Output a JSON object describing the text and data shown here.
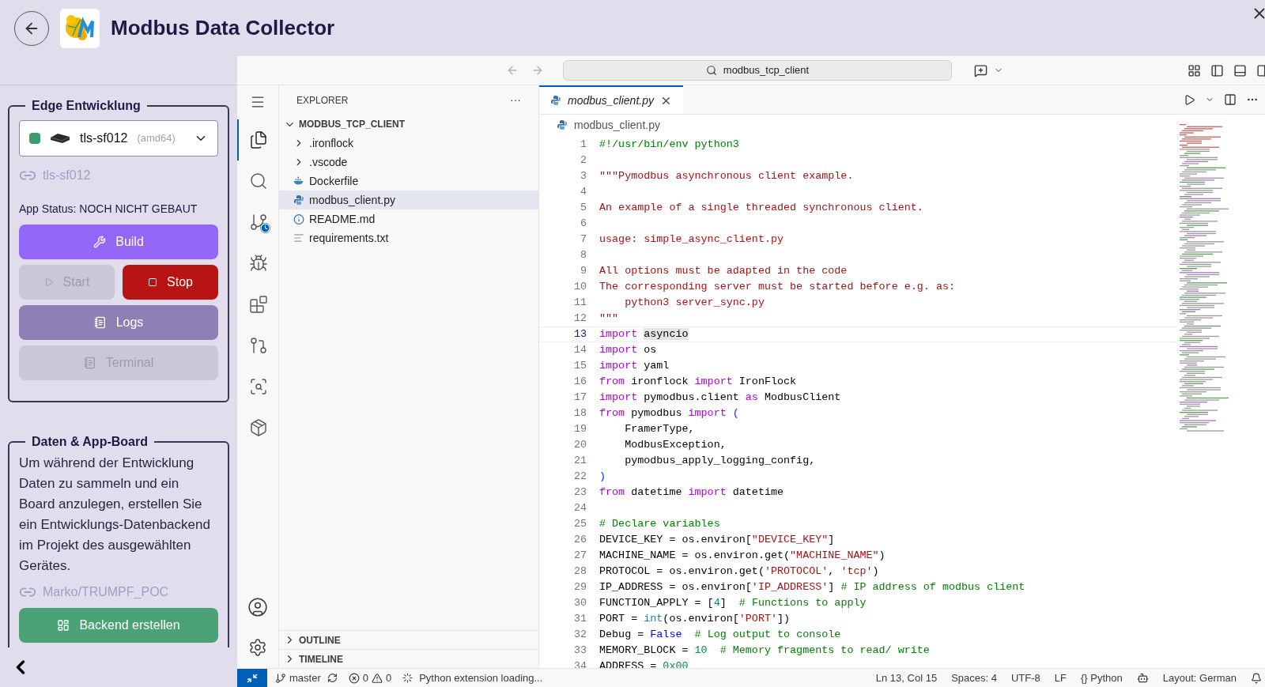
{
  "header": {
    "title": "Modbus Data Collector"
  },
  "edge_panel": {
    "legend": "Edge Entwicklung",
    "device": {
      "name": "tls-sf012",
      "arch": "(amd64)",
      "color": "#3d9b6e"
    },
    "link": "tls-sf012",
    "status": "App Status: NOCH NICHT GEBAUT",
    "buttons": [
      {
        "label": "Build",
        "kind": "primary",
        "disabled": false
      },
      {
        "label": "Start",
        "kind": "neutral",
        "disabled": true
      },
      {
        "label": "Stop",
        "kind": "danger",
        "disabled": false
      },
      {
        "label": "Logs",
        "kind": "secondary",
        "disabled": false
      },
      {
        "label": "Terminal",
        "kind": "neutral",
        "disabled": true
      }
    ]
  },
  "data_panel": {
    "legend": "Daten & App-Board",
    "text": "Um während der Entwicklung Daten zu sammeln und ein Board anzulegen, erstellen Sie ein Entwicklungs-Datenbackend im Projekt des ausgewählten Gerätes.",
    "link": "Marko/TRUMPF_POC",
    "button": {
      "label": "Backend erstellen",
      "kind": "success",
      "disabled": false
    }
  },
  "command_center": {
    "value": "modbus_tcp_client"
  },
  "activity_bar": [
    {
      "kind": "explorer",
      "selected": true
    },
    {
      "kind": "search",
      "selected": false
    },
    {
      "kind": "scm",
      "selected": false
    },
    {
      "kind": "debug",
      "selected": false
    },
    {
      "kind": "extensions",
      "selected": false
    },
    {
      "kind": "graph",
      "selected": false
    },
    {
      "kind": "inspect",
      "selected": false
    },
    {
      "kind": "container",
      "selected": false
    }
  ],
  "explorer": {
    "title": "EXPLORER",
    "more": "···",
    "root": {
      "label": "MODBUS_TCP_CLIENT",
      "expanded": true,
      "children": [
        {
          "label": ".ironflock",
          "kind": "folder",
          "expanded": false,
          "selected": false
        },
        {
          "label": ".vscode",
          "kind": "folder",
          "expanded": false,
          "selected": false
        },
        {
          "label": "Dockerfile",
          "kind": "docker",
          "selected": false
        },
        {
          "label": "modbus_client.py",
          "kind": "python",
          "selected": true
        },
        {
          "label": "README.md",
          "kind": "info",
          "selected": false
        },
        {
          "label": "requirements.txt",
          "kind": "text",
          "selected": false
        }
      ]
    },
    "sections": [
      {
        "label": "OUTLINE",
        "expanded": false
      },
      {
        "label": "TIMELINE",
        "expanded": false
      }
    ]
  },
  "tab": {
    "label": "modbus_client.py",
    "selected": true
  },
  "breadcrumb": "modbus_client.py",
  "code": [
    {
      "n": "1",
      "current": false,
      "segs": [
        {
          "kind": "comment",
          "text": "#!/usr/bin/env python3"
        }
      ]
    },
    {
      "n": "2",
      "current": false
    },
    {
      "n": "3",
      "current": false,
      "segs": [
        {
          "kind": "string",
          "text": "\"\"\"Pymodbus asynchronous client example."
        }
      ]
    },
    {
      "n": "4",
      "current": false
    },
    {
      "n": "5",
      "current": false,
      "segs": [
        {
          "kind": "string",
          "text": "An example of a single threaded synchronous client."
        }
      ]
    },
    {
      "n": "6",
      "current": false
    },
    {
      "n": "7",
      "current": false,
      "segs": [
        {
          "kind": "string",
          "text": "usage: simple_async_client.py"
        }
      ]
    },
    {
      "n": "8",
      "current": false
    },
    {
      "n": "9",
      "current": false,
      "segs": [
        {
          "kind": "string",
          "text": "All options must be adapted in the code"
        }
      ]
    },
    {
      "n": "10",
      "current": false,
      "segs": [
        {
          "kind": "string",
          "text": "The corresponding server must be started before e.g. as:"
        }
      ]
    },
    {
      "n": "11",
      "current": false,
      "segs": [
        {
          "kind": "string",
          "text": "    python3 server_sync.py"
        }
      ]
    },
    {
      "n": "12",
      "current": false,
      "segs": [
        {
          "kind": "string",
          "text": "\"\"\""
        }
      ]
    },
    {
      "n": "13",
      "current": true,
      "segs": [
        {
          "kind": "keyword",
          "text": "import "
        },
        {
          "kind": "highlight",
          "text": "asyncio"
        }
      ]
    },
    {
      "n": "14",
      "current": false,
      "segs": [
        {
          "kind": "keyword",
          "text": "import "
        },
        {
          "kind": "plain",
          "text": "os"
        }
      ]
    },
    {
      "n": "15",
      "current": false,
      "segs": [
        {
          "kind": "keyword",
          "text": "import "
        },
        {
          "kind": "plain",
          "text": "yaml"
        }
      ]
    },
    {
      "n": "16",
      "current": false,
      "segs": [
        {
          "kind": "keyword",
          "text": "from "
        },
        {
          "kind": "plain",
          "text": "ironflock "
        },
        {
          "kind": "keyword",
          "text": "import "
        },
        {
          "kind": "plain",
          "text": "IronFlock"
        }
      ]
    },
    {
      "n": "17",
      "current": false,
      "segs": [
        {
          "kind": "keyword",
          "text": "import "
        },
        {
          "kind": "plain",
          "text": "pymodbus.client "
        },
        {
          "kind": "keyword",
          "text": "as "
        },
        {
          "kind": "plain",
          "text": "ModbusClient"
        }
      ]
    },
    {
      "n": "18",
      "current": false,
      "segs": [
        {
          "kind": "keyword",
          "text": "from "
        },
        {
          "kind": "plain",
          "text": "pymodbus "
        },
        {
          "kind": "keyword",
          "text": "import "
        },
        {
          "kind": "bracket",
          "text": "("
        }
      ]
    },
    {
      "n": "19",
      "current": false,
      "segs": [
        {
          "kind": "plain",
          "text": "    FramerType,"
        }
      ]
    },
    {
      "n": "20",
      "current": false,
      "segs": [
        {
          "kind": "plain",
          "text": "    ModbusException,"
        }
      ]
    },
    {
      "n": "21",
      "current": false,
      "segs": [
        {
          "kind": "plain",
          "text": "    pymodbus_apply_logging_config,"
        }
      ]
    },
    {
      "n": "22",
      "current": false,
      "segs": [
        {
          "kind": "bracket",
          "text": ")"
        }
      ]
    },
    {
      "n": "23",
      "current": false,
      "segs": [
        {
          "kind": "keyword",
          "text": "from "
        },
        {
          "kind": "plain",
          "text": "datetime "
        },
        {
          "kind": "keyword",
          "text": "import "
        },
        {
          "kind": "plain",
          "text": "datetime"
        }
      ]
    },
    {
      "n": "24",
      "current": false
    },
    {
      "n": "25",
      "current": false,
      "segs": [
        {
          "kind": "comment",
          "text": "# Declare variables"
        }
      ]
    },
    {
      "n": "26",
      "current": false,
      "segs": [
        {
          "kind": "plain",
          "text": "DEVICE_KEY = os.environ["
        },
        {
          "kind": "string",
          "text": "\"DEVICE_KEY\""
        },
        {
          "kind": "plain",
          "text": "]"
        }
      ]
    },
    {
      "n": "27",
      "current": false,
      "segs": [
        {
          "kind": "plain",
          "text": "MACHINE_NAME = os.environ.get("
        },
        {
          "kind": "string",
          "text": "\"MACHINE_NAME\""
        },
        {
          "kind": "plain",
          "text": ")"
        }
      ]
    },
    {
      "n": "28",
      "current": false,
      "segs": [
        {
          "kind": "plain",
          "text": "PROTOCOL = os.environ.get("
        },
        {
          "kind": "string",
          "text": "'PROTOCOL'"
        },
        {
          "kind": "plain",
          "text": ", "
        },
        {
          "kind": "string",
          "text": "'tcp'"
        },
        {
          "kind": "plain",
          "text": ")"
        }
      ]
    },
    {
      "n": "29",
      "current": false,
      "segs": [
        {
          "kind": "plain",
          "text": "IP_ADDRESS = os.environ["
        },
        {
          "kind": "string",
          "text": "'IP_ADDRESS'"
        },
        {
          "kind": "plain",
          "text": "] "
        },
        {
          "kind": "comment",
          "text": "# IP address of modbus client"
        }
      ]
    },
    {
      "n": "30",
      "current": false,
      "segs": [
        {
          "kind": "plain",
          "text": "FUNCTION_APPLY = ["
        },
        {
          "kind": "number",
          "text": "4"
        },
        {
          "kind": "plain",
          "text": "]  "
        },
        {
          "kind": "comment",
          "text": "# Functions to apply"
        }
      ]
    },
    {
      "n": "31",
      "current": false,
      "segs": [
        {
          "kind": "plain",
          "text": "PORT = "
        },
        {
          "kind": "builtin",
          "text": "int"
        },
        {
          "kind": "plain",
          "text": "(os.environ["
        },
        {
          "kind": "string",
          "text": "'PORT'"
        },
        {
          "kind": "plain",
          "text": "])"
        }
      ]
    },
    {
      "n": "32",
      "current": false,
      "segs": [
        {
          "kind": "plain",
          "text": "Debug = "
        },
        {
          "kind": "constant",
          "text": "False"
        },
        {
          "kind": "comment",
          "text": "  # Log output to console"
        }
      ]
    },
    {
      "n": "33",
      "current": false,
      "segs": [
        {
          "kind": "plain",
          "text": "MEMORY_BLOCK = "
        },
        {
          "kind": "number",
          "text": "10"
        },
        {
          "kind": "comment",
          "text": "  # Memory fragments to read/ write"
        }
      ]
    },
    {
      "n": "34",
      "current": false,
      "segs": [
        {
          "kind": "plain",
          "text": "ADDRESS = "
        },
        {
          "kind": "number",
          "text": "0x00"
        }
      ]
    }
  ],
  "status_bar": {
    "branch": "master",
    "errors": "0",
    "warnings": "0",
    "progress": "Python extension loading...",
    "position": "Ln 13, Col 15",
    "indent": "Spaces: 4",
    "encoding": "UTF-8",
    "eol": "LF",
    "language_glyph": "{}",
    "language": "Python",
    "layout": "Layout: German"
  }
}
